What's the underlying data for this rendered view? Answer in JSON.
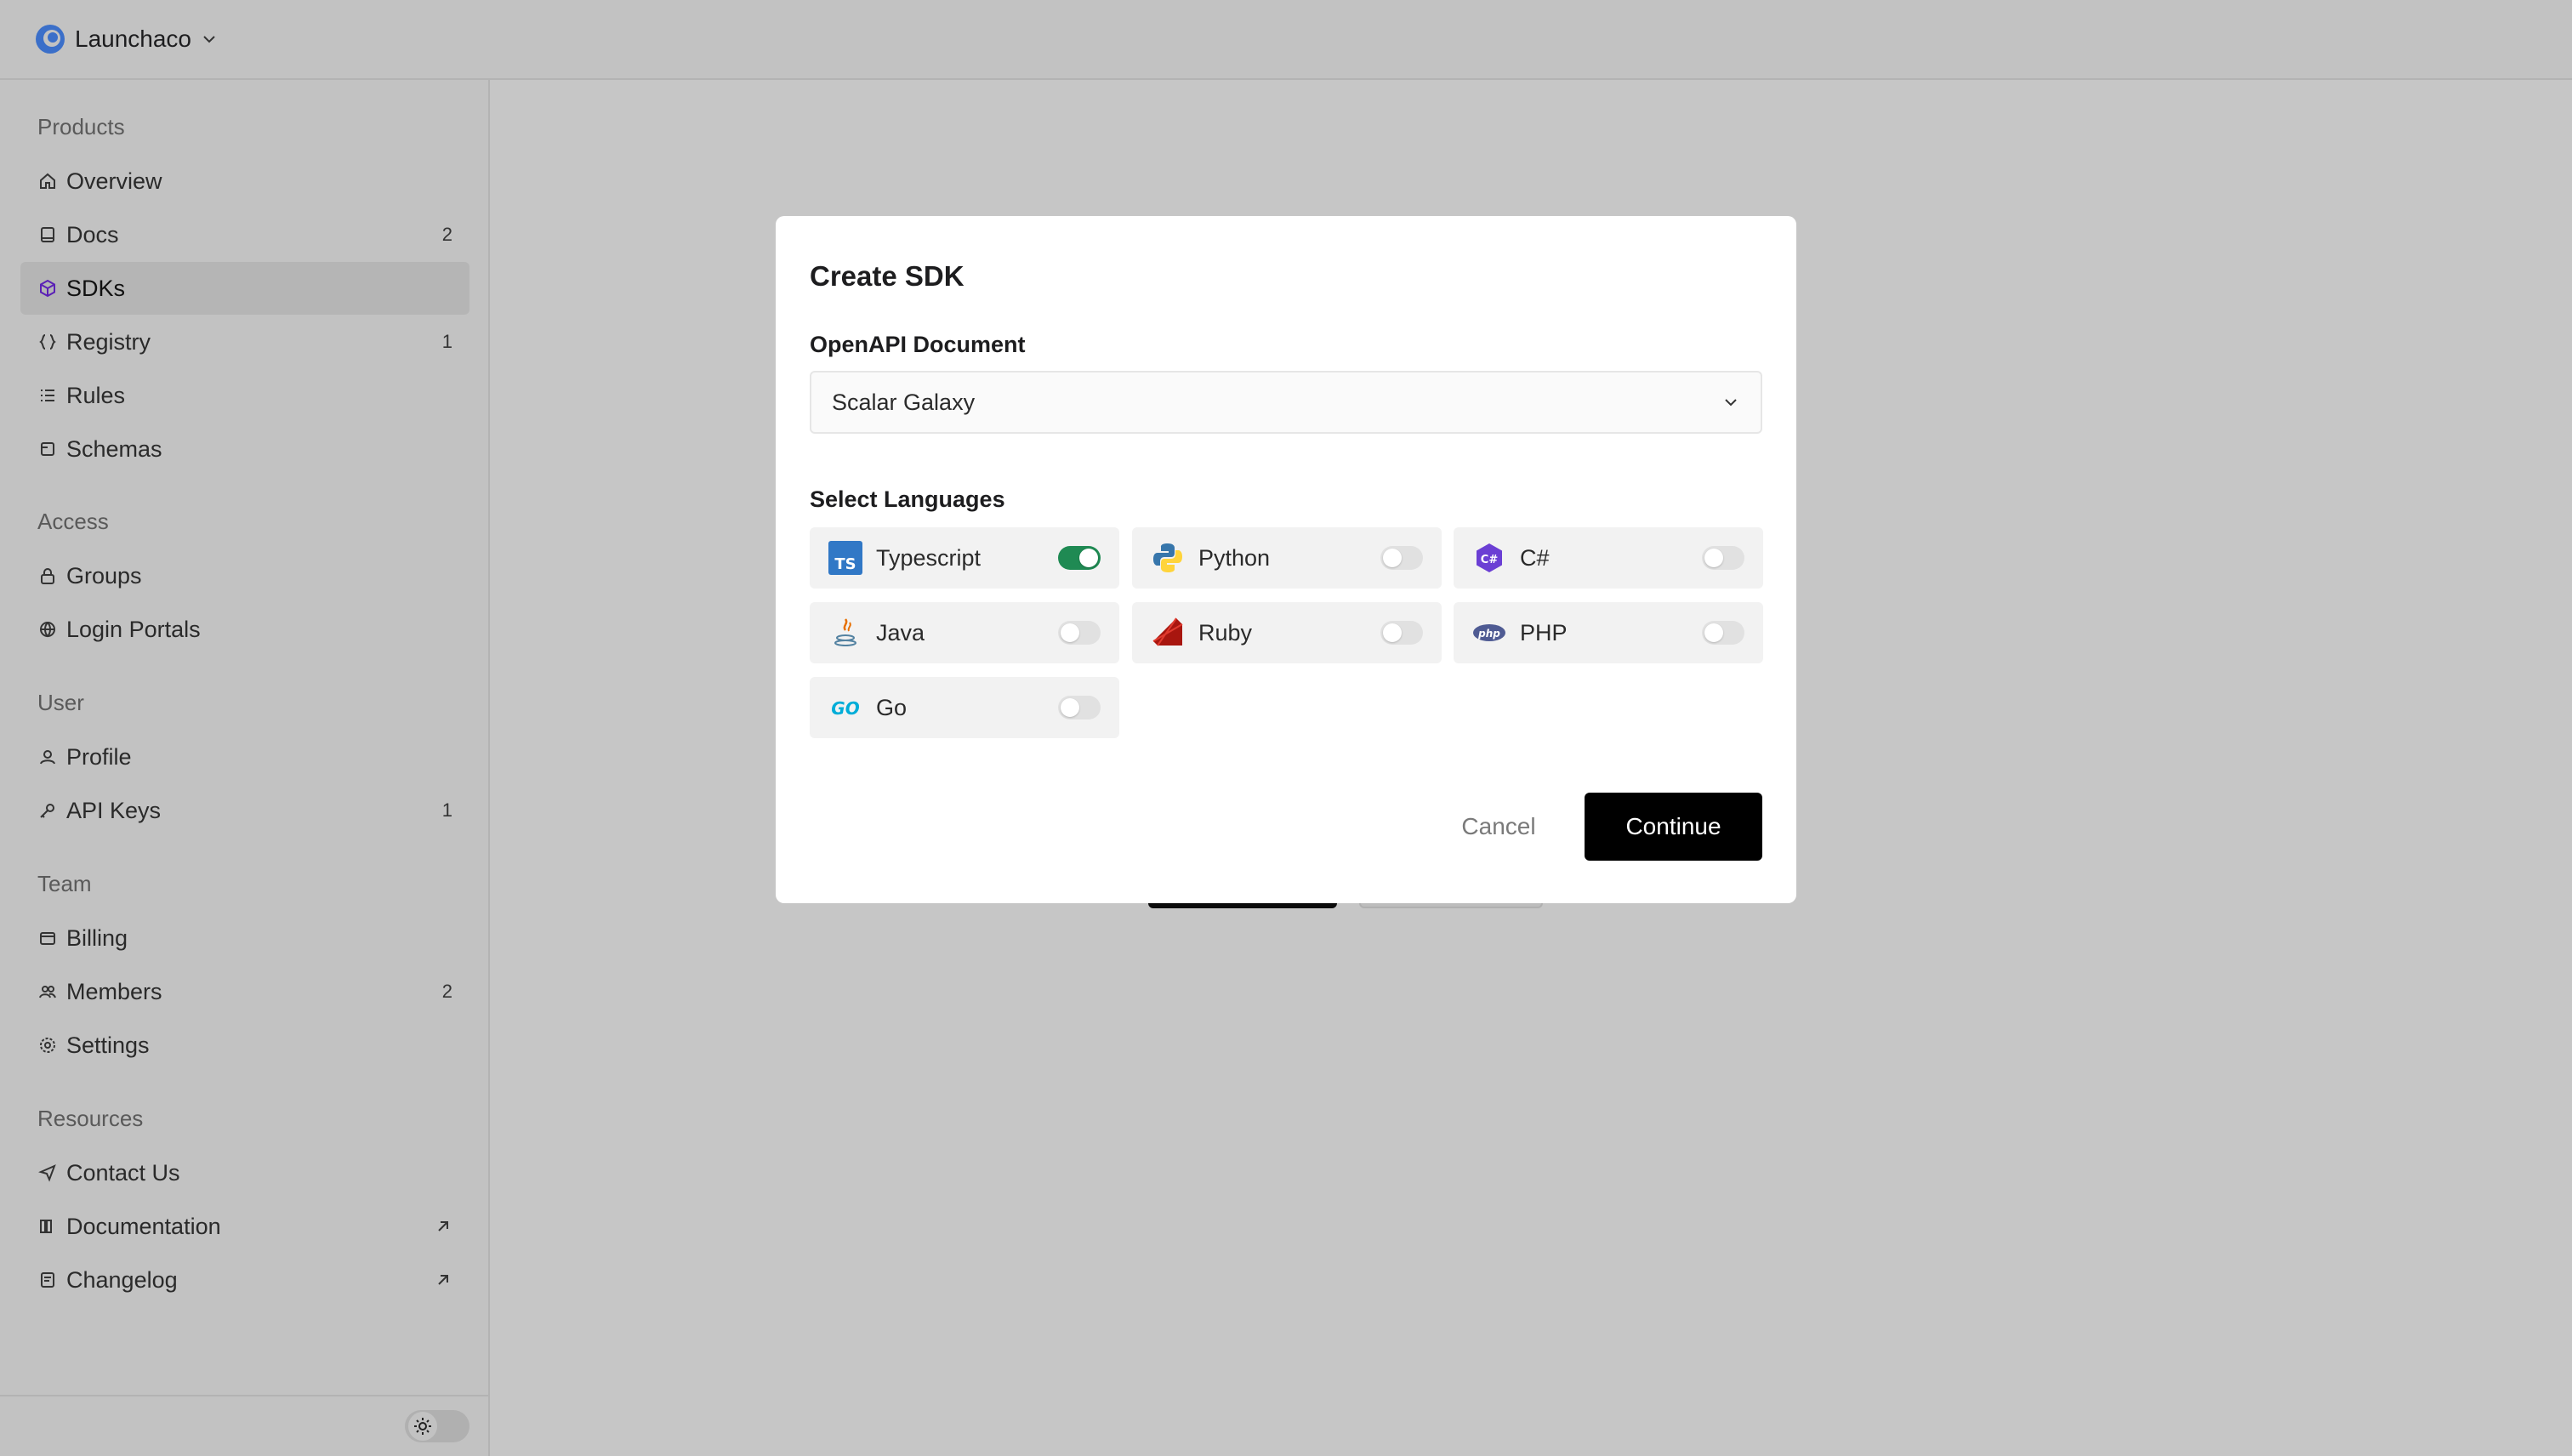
{
  "team": {
    "name": "Launchaco"
  },
  "sidebar": {
    "sections": [
      {
        "title": "Products",
        "items": [
          {
            "label": "Overview",
            "icon": "home-icon",
            "count": ""
          },
          {
            "label": "Docs",
            "icon": "book-icon",
            "count": "2"
          },
          {
            "label": "SDKs",
            "icon": "cube-icon",
            "count": "",
            "active": true
          },
          {
            "label": "Registry",
            "icon": "braces-icon",
            "count": "1"
          },
          {
            "label": "Rules",
            "icon": "list-icon",
            "count": ""
          },
          {
            "label": "Schemas",
            "icon": "schema-icon",
            "count": ""
          }
        ]
      },
      {
        "title": "Access",
        "items": [
          {
            "label": "Groups",
            "icon": "lock-icon",
            "count": ""
          },
          {
            "label": "Login Portals",
            "icon": "globe-icon",
            "count": ""
          }
        ]
      },
      {
        "title": "User",
        "items": [
          {
            "label": "Profile",
            "icon": "user-icon",
            "count": ""
          },
          {
            "label": "API Keys",
            "icon": "key-icon",
            "count": "1"
          }
        ]
      },
      {
        "title": "Team",
        "items": [
          {
            "label": "Billing",
            "icon": "wallet-icon",
            "count": ""
          },
          {
            "label": "Members",
            "icon": "users-icon",
            "count": "2"
          },
          {
            "label": "Settings",
            "icon": "gear-icon",
            "count": ""
          }
        ]
      },
      {
        "title": "Resources",
        "items": [
          {
            "label": "Contact Us",
            "icon": "send-icon",
            "count": ""
          },
          {
            "label": "Documentation",
            "icon": "library-icon",
            "count": "",
            "external": true
          },
          {
            "label": "Changelog",
            "icon": "notes-icon",
            "count": "",
            "external": true
          }
        ]
      }
    ]
  },
  "modal": {
    "title": "Create SDK",
    "document_label": "OpenAPI Document",
    "document_value": "Scalar Galaxy",
    "languages_label": "Select Languages",
    "languages": [
      {
        "name": "Typescript",
        "icon": "typescript-icon",
        "enabled": true
      },
      {
        "name": "Python",
        "icon": "python-icon",
        "enabled": false
      },
      {
        "name": "C#",
        "icon": "csharp-icon",
        "enabled": false
      },
      {
        "name": "Java",
        "icon": "java-icon",
        "enabled": false
      },
      {
        "name": "Ruby",
        "icon": "ruby-icon",
        "enabled": false
      },
      {
        "name": "PHP",
        "icon": "php-icon",
        "enabled": false
      },
      {
        "name": "Go",
        "icon": "go-icon",
        "enabled": false
      }
    ],
    "cancel_label": "Cancel",
    "continue_label": "Continue"
  },
  "colors": {
    "accent": "#1f8a53",
    "active_nav": "#5b21b6",
    "primary_button": "#000000"
  }
}
